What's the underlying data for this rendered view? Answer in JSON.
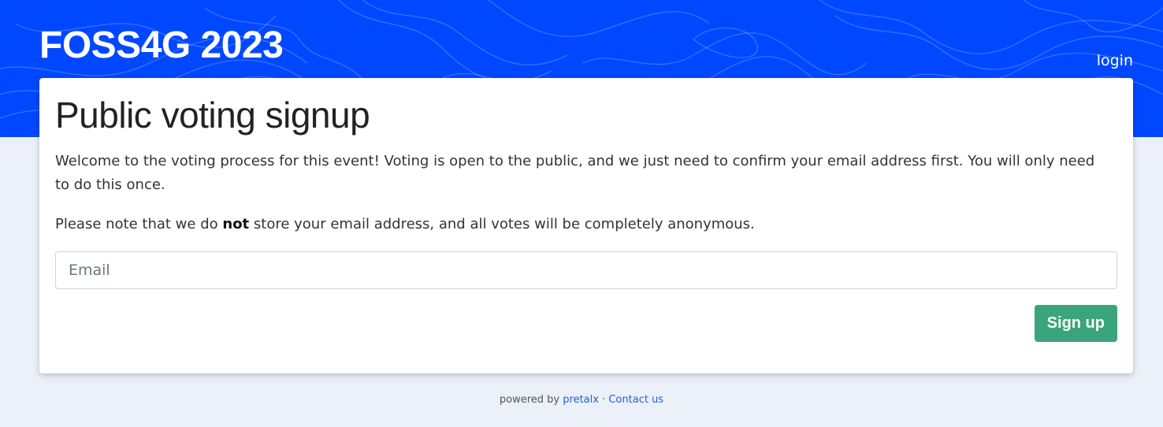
{
  "header": {
    "event_title": "FOSS4G 2023",
    "login_label": "login"
  },
  "main": {
    "title": "Public voting signup",
    "intro": "Welcome to the voting process for this event! Voting is open to the public, and we just need to confirm your email address first. You will only need to do this once.",
    "note_before": "Please note that we do ",
    "note_bold": "not",
    "note_after": " store your email address, and all votes will be completely anonymous.",
    "email": {
      "placeholder": "Email",
      "value": ""
    },
    "signup_label": "Sign up"
  },
  "footer": {
    "powered_by": "powered by",
    "pretalx_label": "pretalx",
    "separator": " · ",
    "contact_label": "Contact us"
  },
  "colors": {
    "header_bg": "#0048ff",
    "page_bg": "#ebf0f9",
    "button_bg": "#3aa57c",
    "link": "#1d62d6"
  }
}
